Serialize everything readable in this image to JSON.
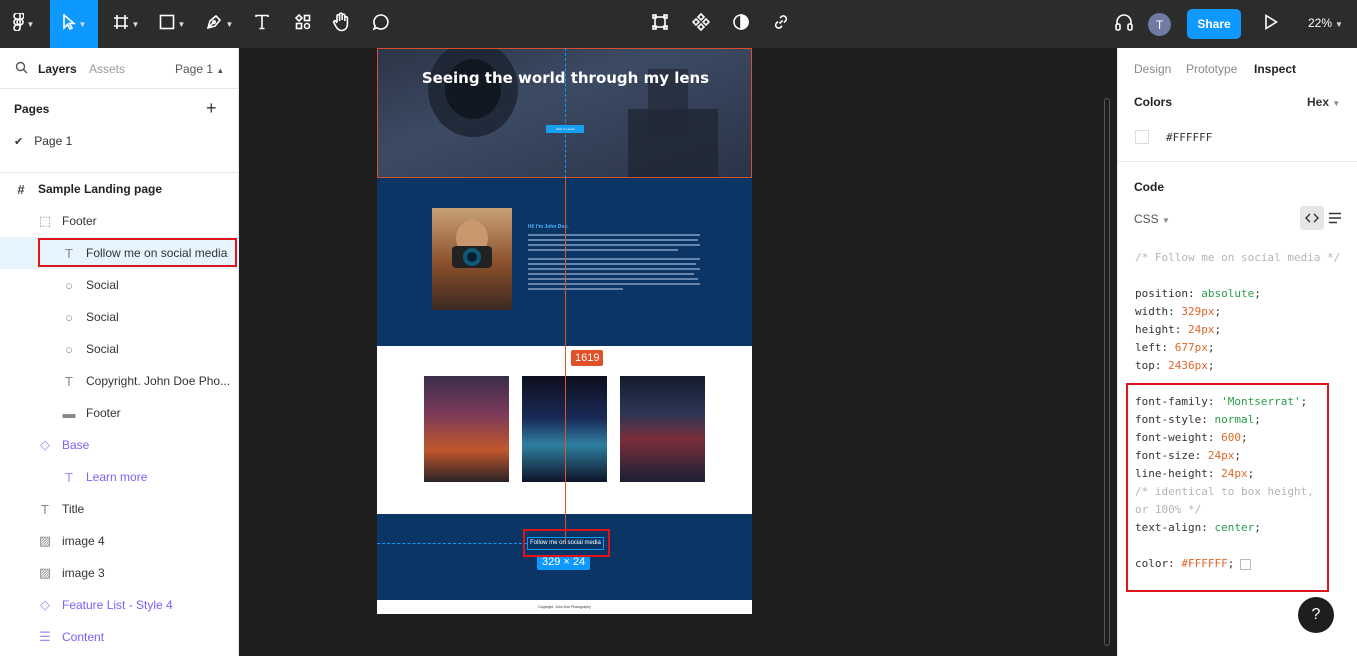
{
  "toolbar": {
    "tools": [
      {
        "icon": "figma-menu-icon"
      },
      {
        "icon": "move-tool-icon",
        "active": true
      },
      {
        "icon": "frame-tool-icon"
      },
      {
        "icon": "shape-tool-icon"
      },
      {
        "icon": "pen-tool-icon"
      },
      {
        "icon": "text-tool-icon"
      },
      {
        "icon": "resources-icon"
      },
      {
        "icon": "hand-tool-icon"
      },
      {
        "icon": "comment-tool-icon"
      }
    ],
    "center_tools": [
      "crop-icon",
      "component-icon",
      "contrast-icon",
      "link-icon"
    ],
    "avatar_initial": "T",
    "share_label": "Share",
    "zoom_label": "22%",
    "accent": "#0d99ff"
  },
  "left_panel": {
    "tab_layers": "Layers",
    "tab_assets": "Assets",
    "page_selector": "Page 1",
    "pages_title": "Pages",
    "pages": [
      {
        "label": "Page 1",
        "checked": true
      }
    ],
    "frame_name": "Sample Landing page",
    "layers": [
      {
        "label": "Footer",
        "icon": "dashed-frame-icon",
        "style": "normal"
      },
      {
        "label": "Follow me on social media",
        "icon": "text-icon",
        "style": "selected"
      },
      {
        "label": "Social",
        "icon": "ellipse-icon",
        "style": "normal"
      },
      {
        "label": "Social",
        "icon": "ellipse-icon",
        "style": "normal"
      },
      {
        "label": "Social",
        "icon": "ellipse-icon",
        "style": "normal"
      },
      {
        "label": "Copyright. John Doe Pho...",
        "icon": "text-icon",
        "style": "normal"
      },
      {
        "label": "Footer",
        "icon": "rectangle-icon",
        "style": "normal"
      },
      {
        "label": "Base",
        "icon": "component-instance-icon",
        "style": "purple"
      },
      {
        "label": "Learn more",
        "icon": "text-icon",
        "style": "purple"
      },
      {
        "label": "Title",
        "icon": "text-icon",
        "style": "normal"
      },
      {
        "label": "image 4",
        "icon": "image-icon",
        "style": "normal"
      },
      {
        "label": "image 3",
        "icon": "image-icon",
        "style": "normal"
      },
      {
        "label": "Feature List - Style 4",
        "icon": "component-instance-icon",
        "style": "purple"
      },
      {
        "label": "Content",
        "icon": "auto-layout-icon",
        "style": "purple"
      }
    ]
  },
  "canvas": {
    "hero_title": "Seeing the world through my lens",
    "hero_button": "View my work",
    "about_name": "Hi! I'm John Doe.",
    "follow_text": "Follow me on social media",
    "footer_text": "Copyright. John Doe Photography",
    "distance_badge": "1619",
    "size_badge": "329 × 24"
  },
  "right_panel": {
    "tabs": [
      "Design",
      "Prototype",
      "Inspect"
    ],
    "active_tab": "Inspect",
    "colors_title": "Colors",
    "color_format": "Hex",
    "color_value": "#FFFFFF",
    "code_title": "Code",
    "code_lang": "CSS",
    "comment": "/* Follow me on social media */",
    "layout_props": [
      {
        "prop": "position",
        "value": "absolute",
        "kind": "s"
      },
      {
        "prop": "width",
        "value": "329px",
        "kind": "n"
      },
      {
        "prop": "height",
        "value": "24px",
        "kind": "n"
      },
      {
        "prop": "left",
        "value": "677px",
        "kind": "n"
      },
      {
        "prop": "top",
        "value": "2436px",
        "kind": "n"
      }
    ],
    "font_props": [
      {
        "prop": "font-family",
        "value": "'Montserrat'",
        "kind": "s"
      },
      {
        "prop": "font-style",
        "value": "normal",
        "kind": "s"
      },
      {
        "prop": "font-weight",
        "value": "600",
        "kind": "n"
      },
      {
        "prop": "font-size",
        "value": "24px",
        "kind": "n"
      },
      {
        "prop": "line-height",
        "value": "24px",
        "kind": "n"
      }
    ],
    "line_height_comment": "/* identical to box height, or 100% */",
    "text_align": {
      "prop": "text-align",
      "value": "center",
      "kind": "s"
    },
    "color_prop": {
      "prop": "color",
      "value": "#FFFFFF",
      "kind": "n"
    },
    "help_label": "?"
  }
}
